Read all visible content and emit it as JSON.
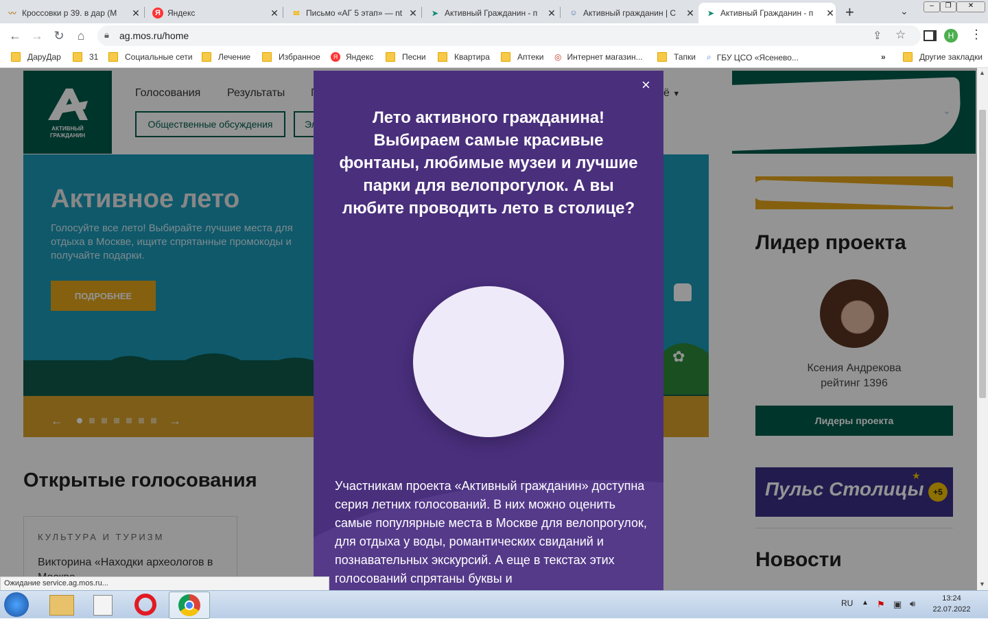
{
  "browser": {
    "tabs": [
      {
        "title": "Кроссовки р 39. в дар (М",
        "icon": "tab-favicon-darudar"
      },
      {
        "title": "Яндекс",
        "icon": "tab-favicon-yandex"
      },
      {
        "title": "Письмо «АГ 5 этап» — nt",
        "icon": "tab-favicon-mail"
      },
      {
        "title": "Активный Гражданин - п",
        "icon": "tab-favicon-ag"
      },
      {
        "title": "Активный гражданин | С",
        "icon": "tab-favicon-ag2"
      },
      {
        "title": "Активный Гражданин - п",
        "icon": "tab-favicon-ag"
      }
    ],
    "url": "ag.mos.ru/home",
    "profile_initial": "Н",
    "bookmarks": [
      "ДаруДар",
      "31",
      "Социальные сети",
      "Лечение",
      "Избранное",
      "Яндекс",
      "Песни",
      "Квартира",
      "Аптеки",
      "Интернет магазин...",
      "Тапки",
      "ГБУ ЦСО «Ясенево..."
    ],
    "other_bookmarks": "Другие закладки",
    "status": "Ожидание service.ag.mos.ru..."
  },
  "site": {
    "logo_line1": "АКТИВНЫЙ",
    "logo_line2": "ГРАЖДАНИН",
    "nav": [
      "Голосования",
      "Результаты",
      "Г"
    ],
    "nav_right": "ё",
    "outline_buttons": [
      "Общественные обсуждения",
      "Эл"
    ],
    "banner": {
      "title": "Активное лето",
      "text": "Голосуйте все лето! Выбирайте лучшие места для отдыха в Москве, ищите спрятанные промокоды и получайте подарки.",
      "button": "ПОДРОБНЕЕ"
    },
    "open_votes_heading": "Открытые голосования",
    "vote_card": {
      "category": "КУЛЬТУРА И ТУРИЗМ",
      "title": "Викторина «Находки археологов в Москве"
    },
    "sidebar": {
      "leader_heading": "Лидер проекта",
      "leader_name": "Ксения Андрекова",
      "leader_rating": "рейтинг 1396",
      "leaders_button": "Лидеры проекта",
      "pulse_banner": "Пульс Столицы",
      "pulse_badge": "+5",
      "news_heading": "Новости"
    }
  },
  "modal": {
    "close": "×",
    "heading": "Лето активного гражданина! Выбираем самые красивые фонтаны, любимые музеи и лучшие парки для велопрогулок. А вы любите проводить лето в столице?",
    "body": "Участникам проекта «Активный гражданин» доступна серия летних голосований. В них можно оценить самые популярные места в Москве для велопрогулок, для отдыха у воды, романтических свиданий и познавательных экскурсий. А еще в текстах этих голосований спрятаны буквы и"
  },
  "taskbar": {
    "lang": "RU",
    "time": "13:24",
    "date": "22.07.2022"
  },
  "colors": {
    "brand_green": "#005c4b",
    "banner_blue": "#1a9ab8",
    "gold": "#e6a51a",
    "modal_purple": "#4a2f7d"
  }
}
